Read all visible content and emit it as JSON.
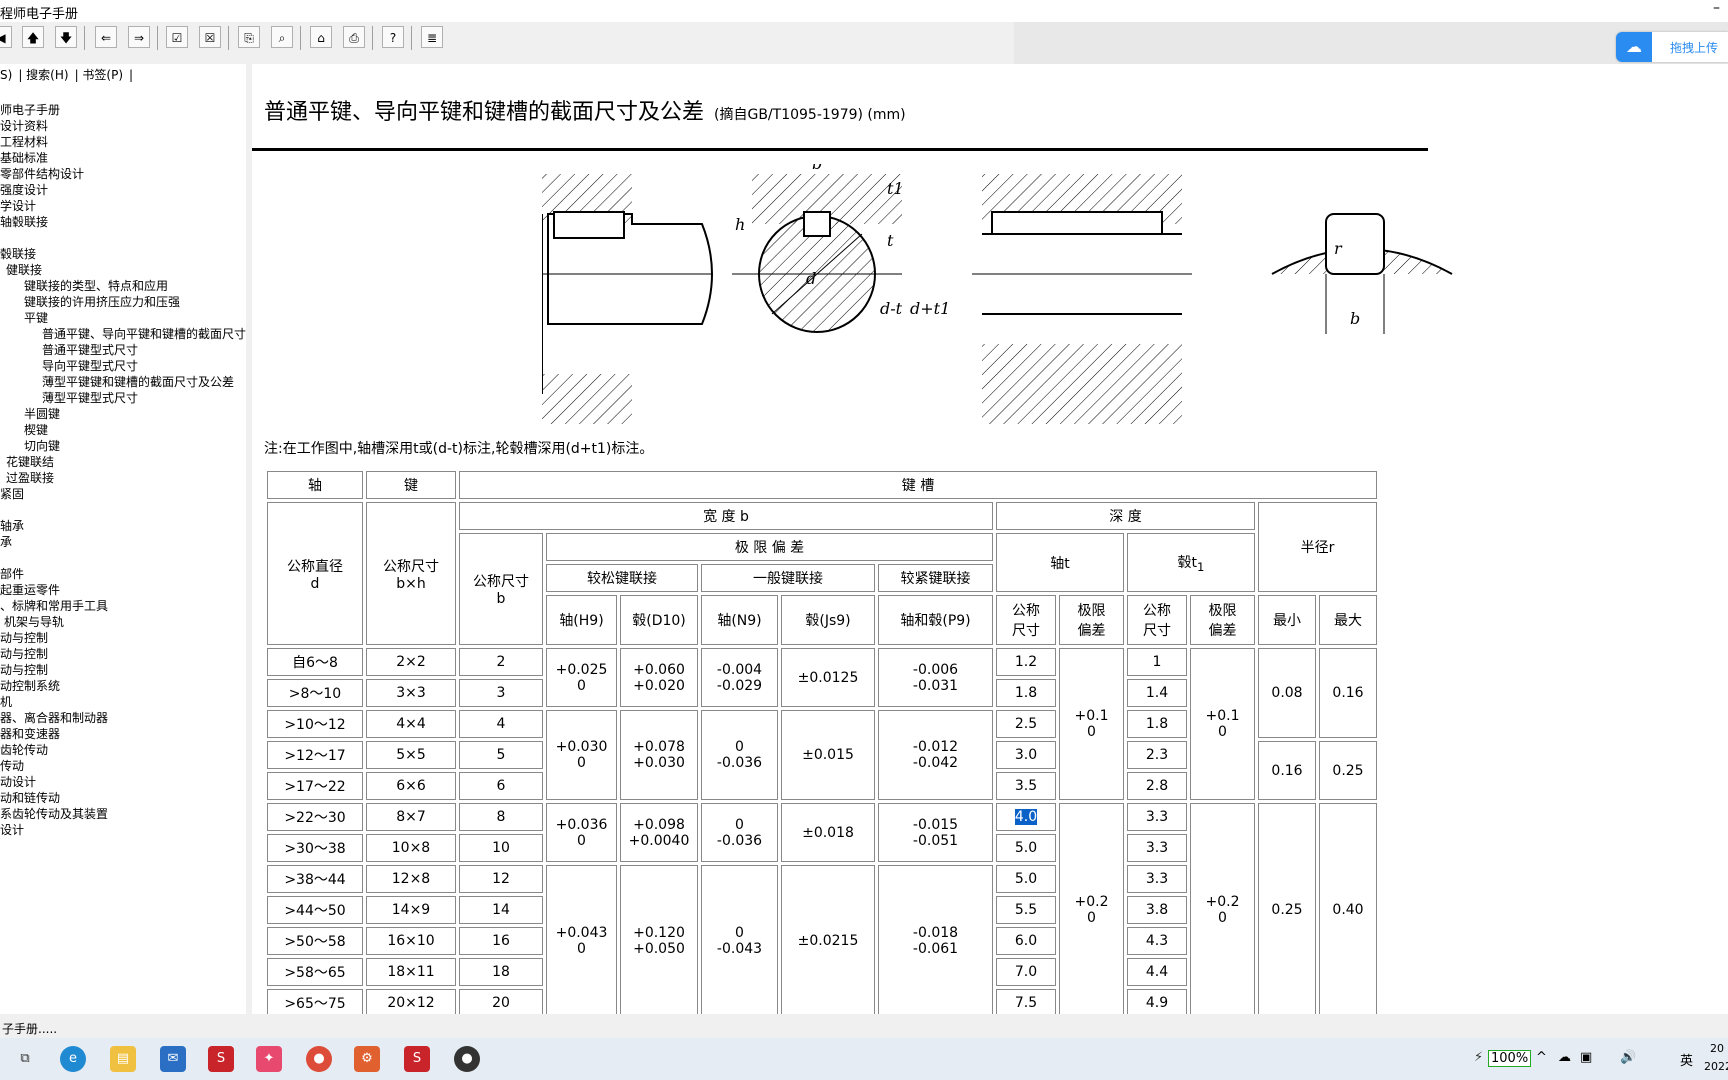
{
  "window": {
    "title": "程师电子手册",
    "minimize": "–"
  },
  "toolbar": {
    "buttons": [
      "up-arrow-icon",
      "down-arrow-icon",
      "left-arrow-icon",
      "right-arrow-icon",
      "check-icon",
      "cross-icon",
      "copy-icon",
      "find-icon",
      "home-icon",
      "print-icon",
      "help-icon",
      "index-icon"
    ]
  },
  "upload": {
    "label": "拖拽上传"
  },
  "sidebar": {
    "tabs": [
      "S)",
      "搜索(H)",
      "书签(P)"
    ],
    "tree": [
      "师电子手册",
      "设计资料",
      "工程材料",
      "基础标准",
      "零部件结构设计",
      "强度设计",
      "学设计",
      "轴毂联接",
      "",
      "毂联接",
      "健联接",
      "键联接的类型、特点和应用",
      "键联接的许用挤压应力和压强",
      "平键",
      "普通平键、导向平键和键槽的截面尺寸",
      "普通平键型式尺寸",
      "导向平键型式尺寸",
      "薄型平键键和键槽的截面尺寸及公差",
      "薄型平键型式尺寸",
      "半圆键",
      "楔键",
      "切向键",
      "花键联结",
      "过盈联接",
      "紧固",
      "",
      "轴承",
      "承",
      "",
      "部件",
      "起重运零件",
      "、标牌和常用手工具",
      "机架与导轨",
      "动与控制",
      "动与控制",
      "动与控制",
      "动控制系统",
      "机",
      "器、离合器和制动器",
      "器和变速器",
      "齿轮传动",
      "传动",
      "动设计",
      "动和链传动",
      "系齿轮传动及其装置",
      "设计"
    ]
  },
  "content": {
    "title": "普通平键、导向平键和键槽的截面尺寸及公差",
    "subtitle": "(摘自GB/T1095-1979)  (mm)",
    "note": "注:在工作图中,轴槽深用t或(d-t)标注,轮毂槽深用(d+t1)标注。",
    "drawing_labels": {
      "b": "b",
      "h": "h",
      "t": "t",
      "t1": "t1",
      "d": "d",
      "d_minus_t": "d-t",
      "d_plus_t1": "d+t1",
      "r": "r"
    }
  },
  "table": {
    "h_shaft": "轴",
    "h_key": "键",
    "h_keyway": "键    槽",
    "h_width": "宽  度  b",
    "h_depth": "深    度",
    "h_radius": "半径r",
    "h_nominal_d": "公称直径\nd",
    "h_key_size": "公称尺寸\nb×h",
    "h_nominal_b": "公称尺寸\nb",
    "h_limit": "极 限 偏 差",
    "h_loose": "较松键联接",
    "h_normal": "一般键联接",
    "h_tight": "较紧键联接",
    "h_shaft_t": "轴t",
    "h_hub_t1": "毂t",
    "h_h9": "轴(H9)",
    "h_d10": "毂(D10)",
    "h_n9": "轴(N9)",
    "h_js9": "毂(Js9)",
    "h_p9": "轴和毂(P9)",
    "h_nom": "公称\n尺寸",
    "h_dev": "极限\n偏差",
    "h_min": "最小",
    "h_max": "最大",
    "rows": [
      {
        "d": "自6～8",
        "bh": "2×2",
        "b": "2",
        "t": "1.2",
        "t1": "1"
      },
      {
        "d": ">8～10",
        "bh": "3×3",
        "b": "3",
        "t": "1.8",
        "t1": "1.4"
      },
      {
        "d": ">10～12",
        "bh": "4×4",
        "b": "4",
        "t": "2.5",
        "t1": "1.8"
      },
      {
        "d": ">12～17",
        "bh": "5×5",
        "b": "5",
        "t": "3.0",
        "t1": "2.3"
      },
      {
        "d": ">17～22",
        "bh": "6×6",
        "b": "6",
        "t": "3.5",
        "t1": "2.8"
      },
      {
        "d": ">22～30",
        "bh": "8×7",
        "b": "8",
        "t": "4.0",
        "t1": "3.3"
      },
      {
        "d": ">30～38",
        "bh": "10×8",
        "b": "10",
        "t": "5.0",
        "t1": "3.3"
      },
      {
        "d": ">38～44",
        "bh": "12×8",
        "b": "12",
        "t": "5.0",
        "t1": "3.3"
      },
      {
        "d": ">44～50",
        "bh": "14×9",
        "b": "14",
        "t": "5.5",
        "t1": "3.8"
      },
      {
        "d": ">50～58",
        "bh": "16×10",
        "b": "16",
        "t": "6.0",
        "t1": "4.3"
      },
      {
        "d": ">58～65",
        "bh": "18×11",
        "b": "18",
        "t": "7.0",
        "t1": "4.4"
      },
      {
        "d": ">65～75",
        "bh": "20×12",
        "b": "20",
        "t": "7.5",
        "t1": "4.9"
      }
    ],
    "groups": {
      "g1": {
        "h9": "+0.025\n0",
        "d10": "+0.060\n+0.020",
        "n9": "-0.004\n-0.029",
        "js9": "±0.0125",
        "p9": "-0.006\n-0.031"
      },
      "g2": {
        "h9": "+0.030\n0",
        "d10": "+0.078\n+0.030",
        "n9": "0\n-0.036",
        "js9": "±0.015",
        "p9": "-0.012\n-0.042"
      },
      "g3": {
        "h9": "+0.036\n0",
        "d10": "+0.098\n+0.0040",
        "n9": "0\n-0.036",
        "js9": "±0.018",
        "p9": "-0.015\n-0.051"
      },
      "g4": {
        "h9": "+0.043\n0",
        "d10": "+0.120\n+0.050",
        "n9": "0\n-0.043",
        "js9": "±0.0215",
        "p9": "-0.018\n-0.061"
      }
    },
    "dev1": "+0.1\n0",
    "dev2": "+0.2\n0",
    "r1": {
      "min": "0.08",
      "max": "0.16"
    },
    "r2": {
      "min": "0.16",
      "max": "0.25"
    },
    "r3": {
      "min": "0.25",
      "max": "0.40"
    }
  },
  "status": {
    "text": "子手册....."
  },
  "taskbar": {
    "battery": "100%",
    "lang": "英",
    "clock_top": "20",
    "clock_bottom": "2022"
  }
}
